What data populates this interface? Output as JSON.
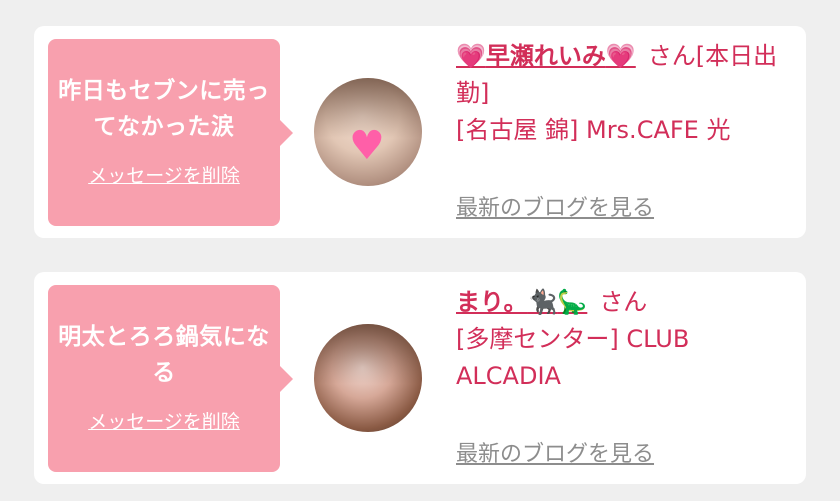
{
  "cards": [
    {
      "message": "昨日もセブンに売ってなかった涙",
      "delete_label": "メッセージを削除",
      "name_prefix": "💗",
      "name": "早瀬れいみ",
      "name_suffix": "💗",
      "honorific": "さん",
      "status": "[本日出勤]",
      "shop": "[名古屋 錦] Mrs.CAFE 光",
      "blog_link": "最新のブログを見る"
    },
    {
      "message": "明太とろろ鍋気になる",
      "delete_label": "メッセージを削除",
      "name": "まり。",
      "name_emoji_cat": "🐈‍⬛",
      "name_emoji_dino": "🦕",
      "honorific": "さん",
      "shop": "[多摩センター] CLUB ALCADIA",
      "blog_link": "最新のブログを見る"
    }
  ],
  "icons": {
    "avatar_heart": "♥"
  },
  "colors": {
    "bubble": "#f8a0ae",
    "accent": "#d22e59",
    "link_gray": "#8d8d8d"
  }
}
